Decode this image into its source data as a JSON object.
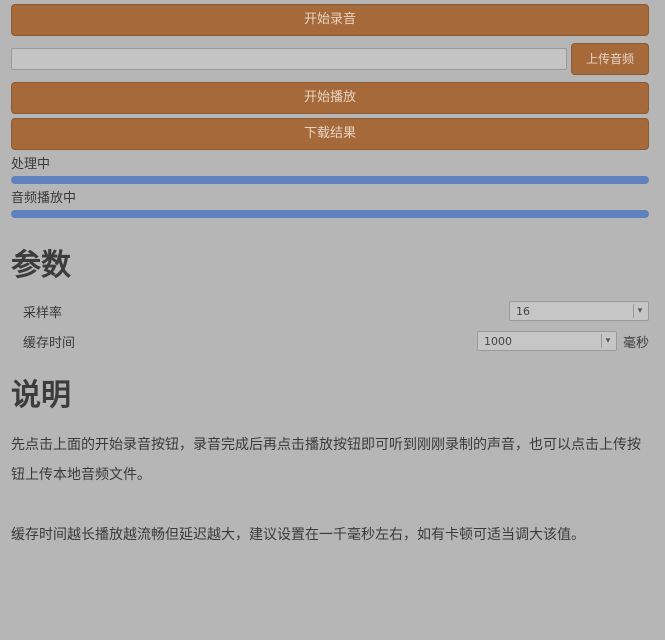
{
  "buttons": {
    "start_recording": "开始录音",
    "upload_audio": "上传音频",
    "play": "开始播放",
    "download": "下载结果"
  },
  "input": {
    "value": "",
    "placeholder": ""
  },
  "progress": {
    "first_label": "处理中",
    "first_value": 1.0,
    "second_label": "音频播放中",
    "second_value": 1.0,
    "color": "#5f82bf"
  },
  "params_section": {
    "title": "参数",
    "rows": [
      {
        "label": "采样率",
        "value": "16",
        "unit": ""
      },
      {
        "label": "缓存时间",
        "value": "1000",
        "unit": "毫秒"
      }
    ]
  },
  "description_section": {
    "title": "说明",
    "paragraphs": [
      "先点击上面的开始录音按钮，录音完成后再点击播放按钮即可听到刚刚录制的声音，也可以点击上传按钮上传本地音频文件。",
      "缓存时间越长播放越流畅但延迟越大，建议设置在一千毫秒左右，如有卡顿可适当调大该值。"
    ]
  },
  "colors": {
    "accent": "#a5693a",
    "background": "#b6b6b6"
  }
}
